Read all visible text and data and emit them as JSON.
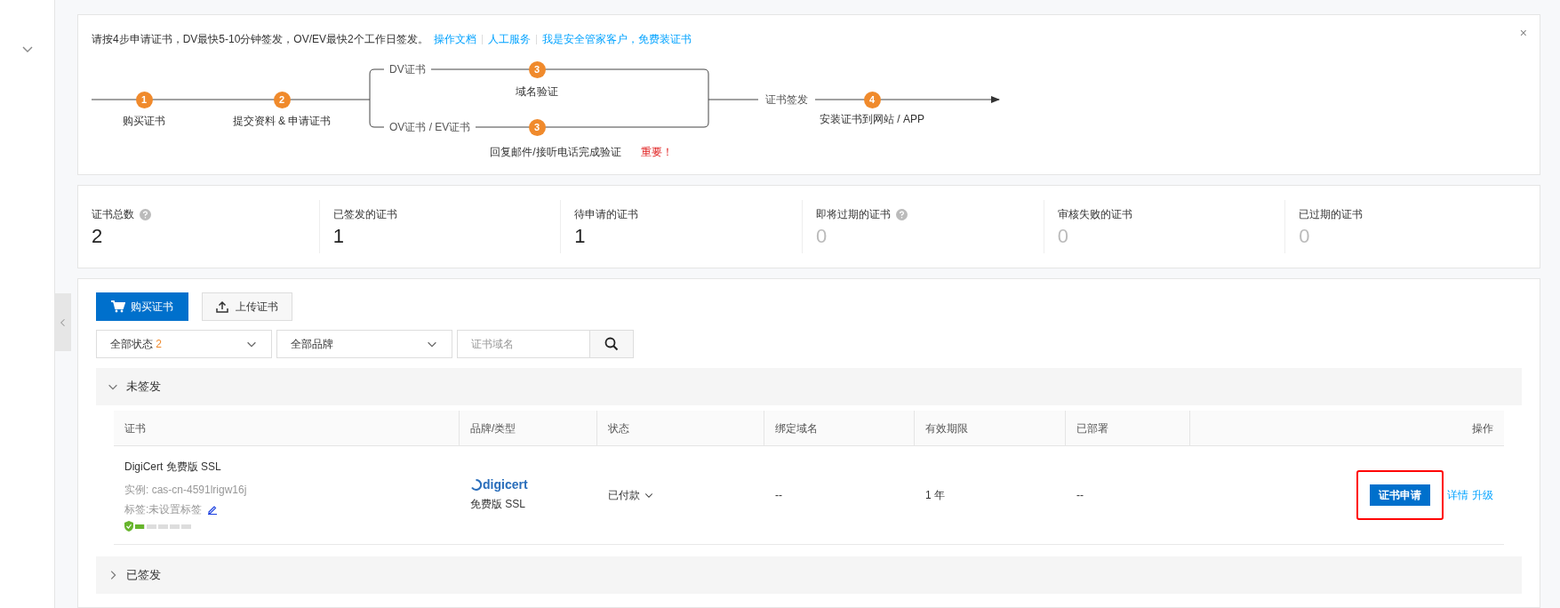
{
  "notice": {
    "text": "请按4步申请证书，DV最快5-10分钟签发，OV/EV最快2个工作日签发。",
    "links": [
      "操作文档",
      "人工服务",
      "我是安全管家客户，免费装证书"
    ],
    "close": "×"
  },
  "flow": {
    "steps": [
      {
        "number": "1",
        "label": "购买证书"
      },
      {
        "number": "2",
        "label": "提交资料 & 申请证书"
      }
    ],
    "branches": [
      {
        "type": "DV证书",
        "number": "3",
        "label": "域名验证"
      },
      {
        "type": "OV证书 / EV证书",
        "number": "3",
        "label": "回复邮件/接听电话完成验证",
        "note": "重要！"
      }
    ],
    "issue_label": "证书签发",
    "final": {
      "number": "4",
      "label": "安装证书到网站 / APP"
    }
  },
  "stats": [
    {
      "label": "证书总数",
      "value": "2",
      "help": true,
      "dimmed": false
    },
    {
      "label": "已签发的证书",
      "value": "1",
      "help": false,
      "dimmed": false
    },
    {
      "label": "待申请的证书",
      "value": "1",
      "help": false,
      "dimmed": false
    },
    {
      "label": "即将过期的证书",
      "value": "0",
      "help": true,
      "dimmed": true
    },
    {
      "label": "审核失败的证书",
      "value": "0",
      "help": false,
      "dimmed": true
    },
    {
      "label": "已过期的证书",
      "value": "0",
      "help": false,
      "dimmed": true
    }
  ],
  "toolbar": {
    "buy": "购买证书",
    "upload": "上传证书"
  },
  "filters": {
    "status": {
      "value": "全部状态",
      "count": "2"
    },
    "brand": {
      "value": "全部品牌"
    },
    "search": {
      "placeholder": "证书域名"
    }
  },
  "sections": [
    {
      "title": "未签发",
      "expanded": true,
      "columns": [
        "证书",
        "品牌/类型",
        "状态",
        "绑定域名",
        "有效期限",
        "已部署",
        "操作"
      ],
      "rows": [
        {
          "name": "DigiCert 免费版 SSL",
          "instance": "实例: cas-cn-4591lrigw16j",
          "tag": "标签:未设置标签",
          "security": {
            "level": 0.15
          },
          "brand_logo": "digicert",
          "brand_type": "免费版 SSL",
          "status": "已付款",
          "domain": "--",
          "validity": "1 年",
          "deployed": "--",
          "actions": [
            {
              "kind": "button",
              "label": "证书申请",
              "highlighted": true
            },
            {
              "kind": "link",
              "label": "详情",
              "highlighted": false
            },
            {
              "kind": "link",
              "label": "升级",
              "highlighted": false
            }
          ]
        }
      ]
    },
    {
      "title": "已签发",
      "expanded": false
    }
  ]
}
